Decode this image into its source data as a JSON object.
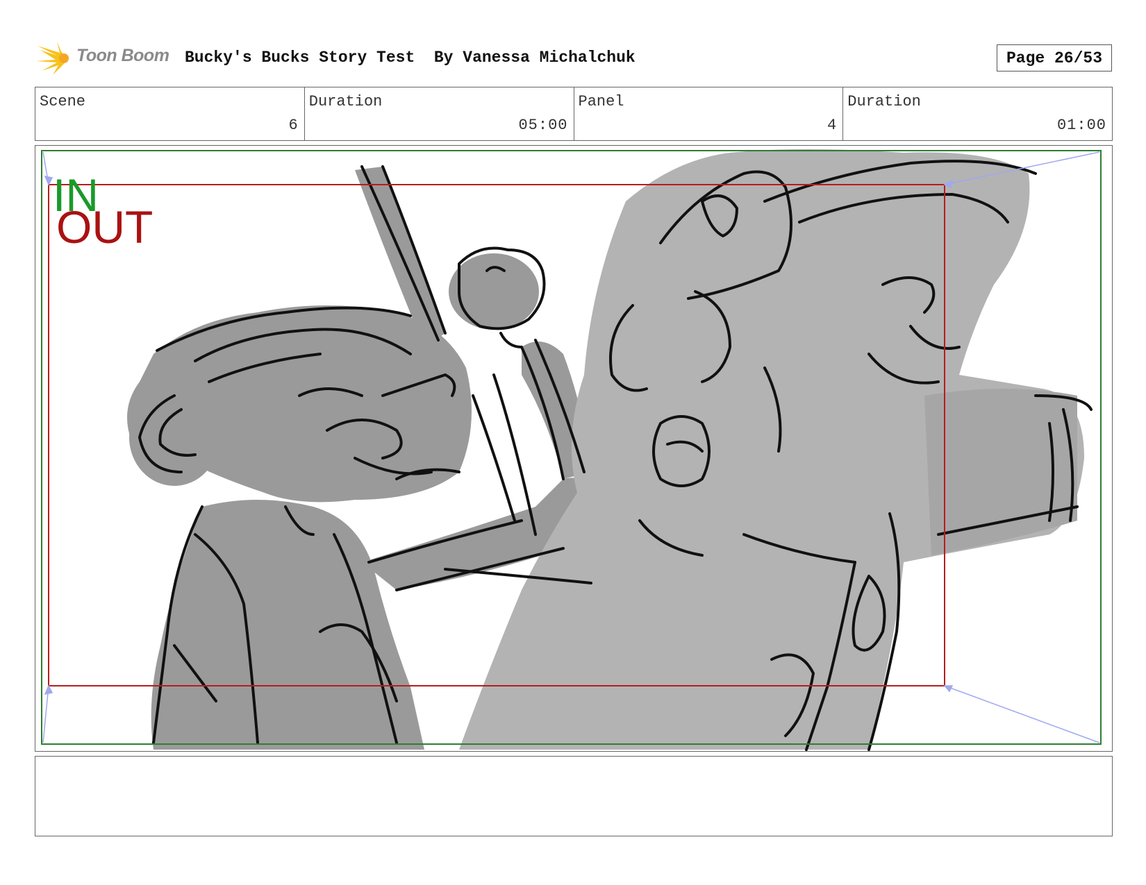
{
  "header": {
    "logo_text": "Toon Boom",
    "title": "Bucky's Bucks Story Test  By Vanessa Michalchuk",
    "page": "Page 26/53"
  },
  "info": {
    "scene_label": "Scene",
    "scene_value": "6",
    "scene_duration_label": "Duration",
    "scene_duration_value": "05:00",
    "panel_label": "Panel",
    "panel_value": "4",
    "panel_duration_label": "Duration",
    "panel_duration_value": "01:00"
  },
  "panel": {
    "in_label": "IN",
    "out_label": "OUT",
    "colors": {
      "in": "#1a9a2a",
      "out": "#aa1111",
      "frame_in": "#2e7d32",
      "frame_out": "#b71c1c",
      "fill": "#a6a6a6"
    }
  },
  "notes": {
    "text": ""
  }
}
